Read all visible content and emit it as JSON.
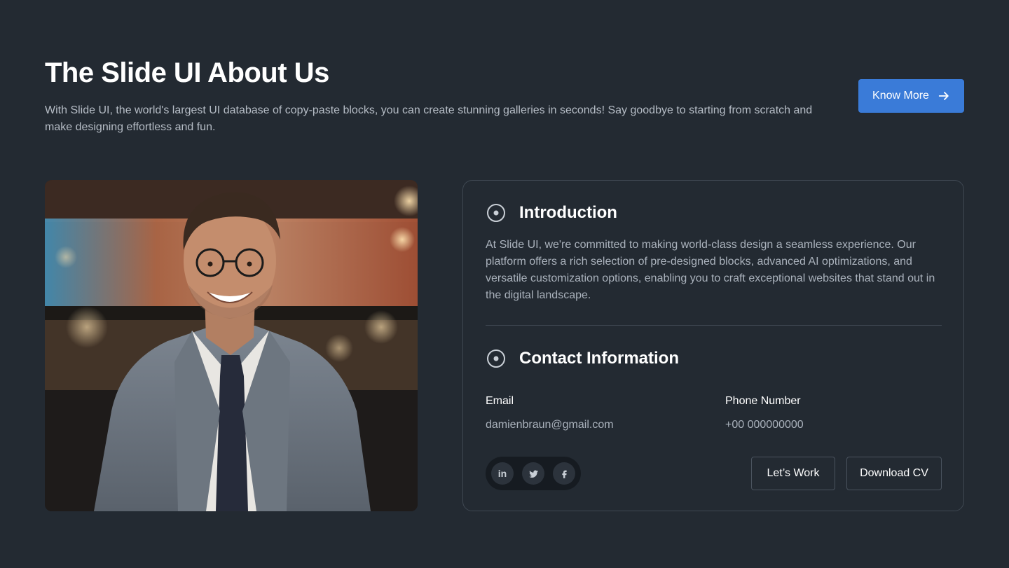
{
  "hero": {
    "title": "The Slide UI About Us",
    "description": "With Slide UI, the world's largest UI database of copy-paste blocks, you can create stunning galleries in seconds! Say goodbye to starting from scratch and make designing effortless and fun.",
    "cta_label": "Know More",
    "cta_icon": "arrow-right-icon",
    "cta_color": "#3a7bd8"
  },
  "portrait": {
    "icon": "profile-photo"
  },
  "introduction": {
    "title": "Introduction",
    "icon": "target-icon",
    "text": "At Slide UI, we're committed to making world-class design a seamless experience. Our platform offers a rich selection of pre-designed blocks, advanced AI optimizations, and versatile customization options, enabling you to craft exceptional websites that stand out in the digital landscape."
  },
  "contact": {
    "title": "Contact Information",
    "icon": "target-icon",
    "email_label": "Email",
    "email_value": "damienbraun@gmail.com",
    "phone_label": "Phone Number",
    "phone_value": "+00 000000000"
  },
  "socials": [
    {
      "name": "linkedin-icon",
      "glyph": "in"
    },
    {
      "name": "twitter-icon"
    },
    {
      "name": "facebook-icon"
    }
  ],
  "actions": {
    "lets_work_label": "Let’s Work",
    "download_cv_label": "Download CV"
  },
  "colors": {
    "background": "#232a32",
    "card_border": "#3f4852",
    "muted_text": "#aab2bc"
  }
}
